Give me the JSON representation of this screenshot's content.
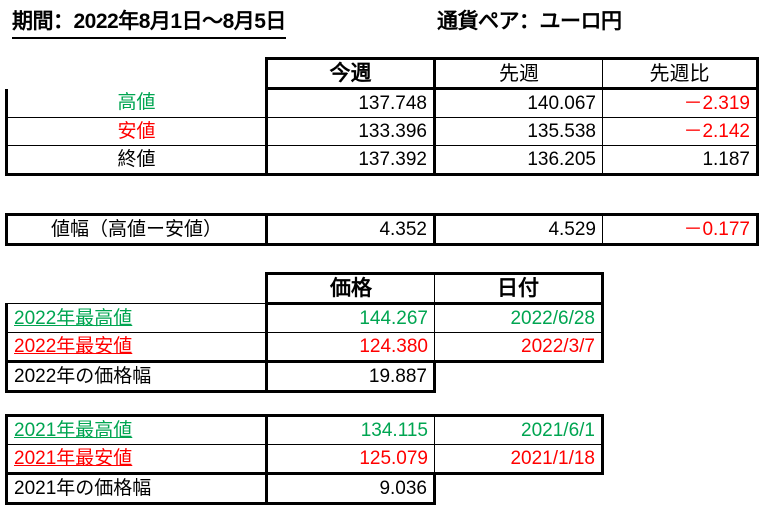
{
  "header": {
    "period_label": "期間：2022年8月1日～8月5日",
    "pair_label": "通貨ペア：ユーロ円"
  },
  "colors": {
    "green": "#00a551",
    "red": "#ff0000",
    "black": "#000000"
  },
  "weekly_table": {
    "columns": [
      "",
      "今週",
      "先週",
      "先週比"
    ],
    "rows": [
      {
        "label": "高値",
        "this_week": "137.748",
        "last_week": "140.067",
        "change": "－2.319"
      },
      {
        "label": "安値",
        "this_week": "133.396",
        "last_week": "135.538",
        "change": "－2.142"
      },
      {
        "label": "終値",
        "this_week": "137.392",
        "last_week": "136.205",
        "change": "1.187"
      }
    ]
  },
  "range_row": {
    "label": "値幅（高値ー安値）",
    "this_week": "4.352",
    "last_week": "4.529",
    "change": "－0.177"
  },
  "year_2022_table": {
    "columns": [
      "",
      "価格",
      "日付"
    ],
    "rows": [
      {
        "label": "2022年最高値",
        "price": "144.267",
        "date": "2022/6/28"
      },
      {
        "label": "2022年最安値",
        "price": "124.380",
        "date": "2022/3/7"
      },
      {
        "label": "2022年の価格幅",
        "price": "19.887",
        "date": ""
      }
    ]
  },
  "year_2021_table": {
    "rows": [
      {
        "label": "2021年最高値",
        "price": "134.115",
        "date": "2021/6/1"
      },
      {
        "label": "2021年最安値",
        "price": "125.079",
        "date": "2021/1/18"
      },
      {
        "label": "2021年の価格幅",
        "price": "9.036",
        "date": ""
      }
    ]
  }
}
